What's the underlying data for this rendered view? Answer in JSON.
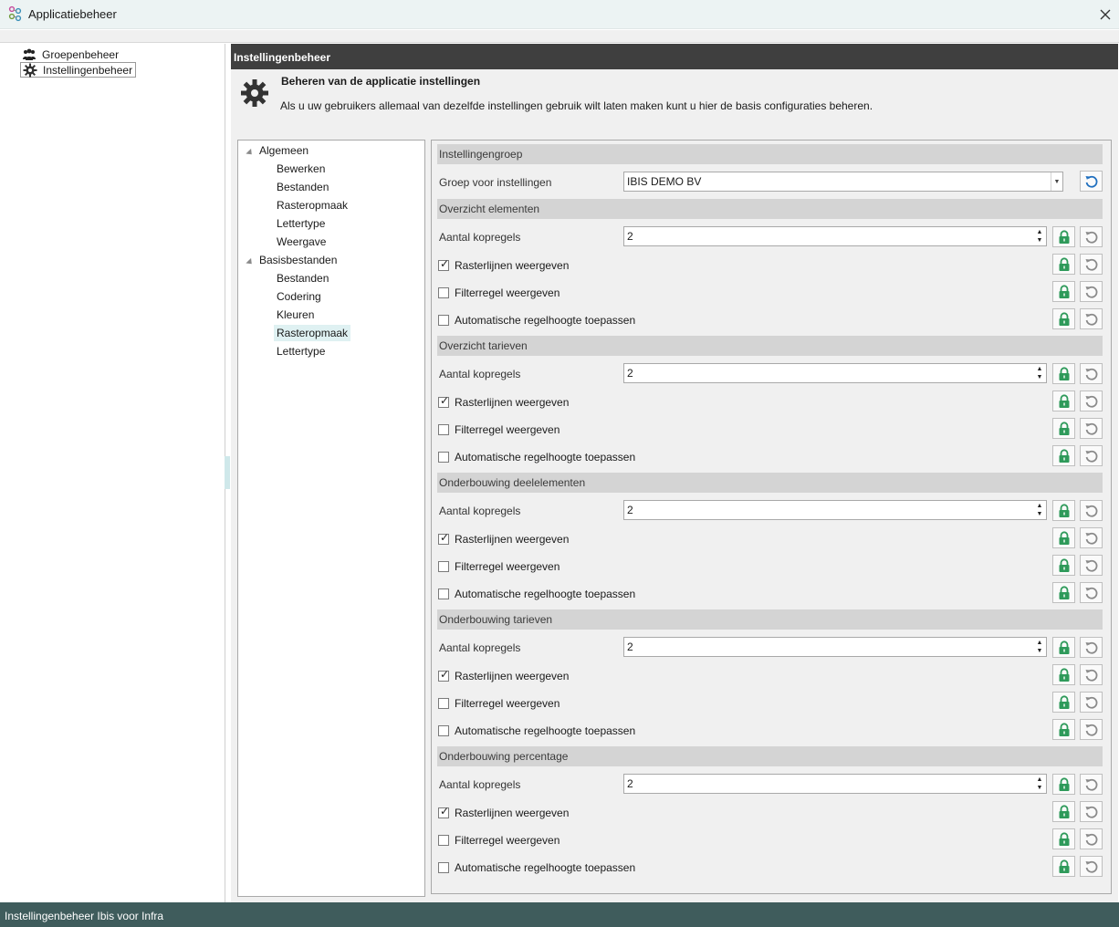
{
  "window": {
    "title": "Applicatiebeheer"
  },
  "nav": {
    "items": [
      {
        "label": "Groepenbeheer",
        "icon": "group-icon"
      },
      {
        "label": "Instellingenbeheer",
        "icon": "gear-icon",
        "selected": true
      }
    ]
  },
  "section": {
    "header": "Instellingenbeheer",
    "title": "Beheren van de applicatie instellingen",
    "description": "Als u uw gebruikers allemaal van dezelfde instellingen gebruik wilt laten maken kunt u hier de basis configuraties beheren."
  },
  "tree": {
    "groups": [
      {
        "label": "Algemeen",
        "children": [
          "Bewerken",
          "Bestanden",
          "Rasteropmaak",
          "Lettertype",
          "Weergave"
        ]
      },
      {
        "label": "Basisbestanden",
        "children": [
          "Bestanden",
          "Codering",
          "Kleuren",
          "Rasteropmaak",
          "Lettertype"
        ]
      }
    ],
    "selected": "Basisbestanden / Rasteropmaak"
  },
  "settings": {
    "instellingengroep": {
      "header": "Instellingengroep",
      "group_label": "Groep voor instellingen",
      "group_value": "IBIS DEMO BV"
    },
    "groups": [
      {
        "header": "Overzicht elementen",
        "kopregels_label": "Aantal kopregels",
        "kopregels_value": "2",
        "checks": [
          {
            "label": "Rasterlijnen weergeven",
            "checked": true
          },
          {
            "label": "Filterregel weergeven",
            "checked": false
          },
          {
            "label": "Automatische regelhoogte toepassen",
            "checked": false
          }
        ]
      },
      {
        "header": "Overzicht tarieven",
        "kopregels_label": "Aantal kopregels",
        "kopregels_value": "2",
        "checks": [
          {
            "label": "Rasterlijnen weergeven",
            "checked": true
          },
          {
            "label": "Filterregel weergeven",
            "checked": false
          },
          {
            "label": "Automatische regelhoogte toepassen",
            "checked": false
          }
        ]
      },
      {
        "header": "Onderbouwing deelelementen",
        "kopregels_label": "Aantal kopregels",
        "kopregels_value": "2",
        "checks": [
          {
            "label": "Rasterlijnen weergeven",
            "checked": true
          },
          {
            "label": "Filterregel weergeven",
            "checked": false
          },
          {
            "label": "Automatische regelhoogte toepassen",
            "checked": false
          }
        ]
      },
      {
        "header": "Onderbouwing tarieven",
        "kopregels_label": "Aantal kopregels",
        "kopregels_value": "2",
        "checks": [
          {
            "label": "Rasterlijnen weergeven",
            "checked": true
          },
          {
            "label": "Filterregel weergeven",
            "checked": false
          },
          {
            "label": "Automatische regelhoogte toepassen",
            "checked": false
          }
        ]
      },
      {
        "header": "Onderbouwing percentage",
        "kopregels_label": "Aantal kopregels",
        "kopregels_value": "2",
        "checks": [
          {
            "label": "Rasterlijnen weergeven",
            "checked": true
          },
          {
            "label": "Filterregel weergeven",
            "checked": false
          },
          {
            "label": "Automatische regelhoogte toepassen",
            "checked": false
          }
        ]
      }
    ]
  },
  "colors": {
    "lock_green": "#2e9a5a",
    "reset_blue": "#1f6fbf",
    "reset_gray": "#8a8a8a",
    "header_dark": "#3f3f3f",
    "status_bg": "#3f5c5c"
  },
  "statusbar": {
    "text": "Instellingenbeheer Ibis voor Infra"
  }
}
